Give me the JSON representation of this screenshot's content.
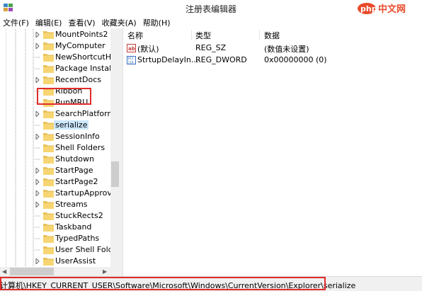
{
  "window": {
    "title": "注册表编辑器"
  },
  "watermark": {
    "text": "php中文网"
  },
  "menu": [
    "文件(F)",
    "编辑(E)",
    "查看(V)",
    "收藏夹(A)",
    "帮助(H)"
  ],
  "tree": {
    "items": [
      {
        "label": "MountPoints2",
        "expandable": true
      },
      {
        "label": "MyComputer",
        "expandable": true
      },
      {
        "label": "NewShortcutHan",
        "expandable": false
      },
      {
        "label": "Package Installat",
        "expandable": false
      },
      {
        "label": "RecentDocs",
        "expandable": true
      },
      {
        "label": "Ribbon",
        "expandable": false
      },
      {
        "label": "RunMRU",
        "expandable": false
      },
      {
        "label": "SearchPlatform",
        "expandable": true
      },
      {
        "label": "serialize",
        "expandable": false,
        "selected": true
      },
      {
        "label": "SessionInfo",
        "expandable": true
      },
      {
        "label": "Shell Folders",
        "expandable": false
      },
      {
        "label": "Shutdown",
        "expandable": false
      },
      {
        "label": "StartPage",
        "expandable": true
      },
      {
        "label": "StartPage2",
        "expandable": true
      },
      {
        "label": "StartupApproved",
        "expandable": true
      },
      {
        "label": "Streams",
        "expandable": true
      },
      {
        "label": "StuckRects2",
        "expandable": false
      },
      {
        "label": "Taskband",
        "expandable": false
      },
      {
        "label": "TypedPaths",
        "expandable": false
      },
      {
        "label": "User Shell Folder",
        "expandable": false
      },
      {
        "label": "UserAssist",
        "expandable": true
      }
    ]
  },
  "values_pane": {
    "headers": {
      "name": "名称",
      "type": "类型",
      "data": "数据"
    },
    "rows": [
      {
        "icon": "string-value-icon",
        "name": "(默认)",
        "type": "REG_SZ",
        "data": "(数值未设置)"
      },
      {
        "icon": "dword-value-icon",
        "name": "StrtupDelayIn...",
        "type": "REG_DWORD",
        "data": "0x00000000 (0)"
      }
    ]
  },
  "statusbar": {
    "path": "计算机\\HKEY_CURRENT_USER\\Software\\Microsoft\\Windows\\CurrentVersion\\Explorer\\serialize"
  },
  "colors": {
    "selection": "#cce8ff",
    "highlight": "#e22b2b",
    "folder": "#e8c25a"
  }
}
